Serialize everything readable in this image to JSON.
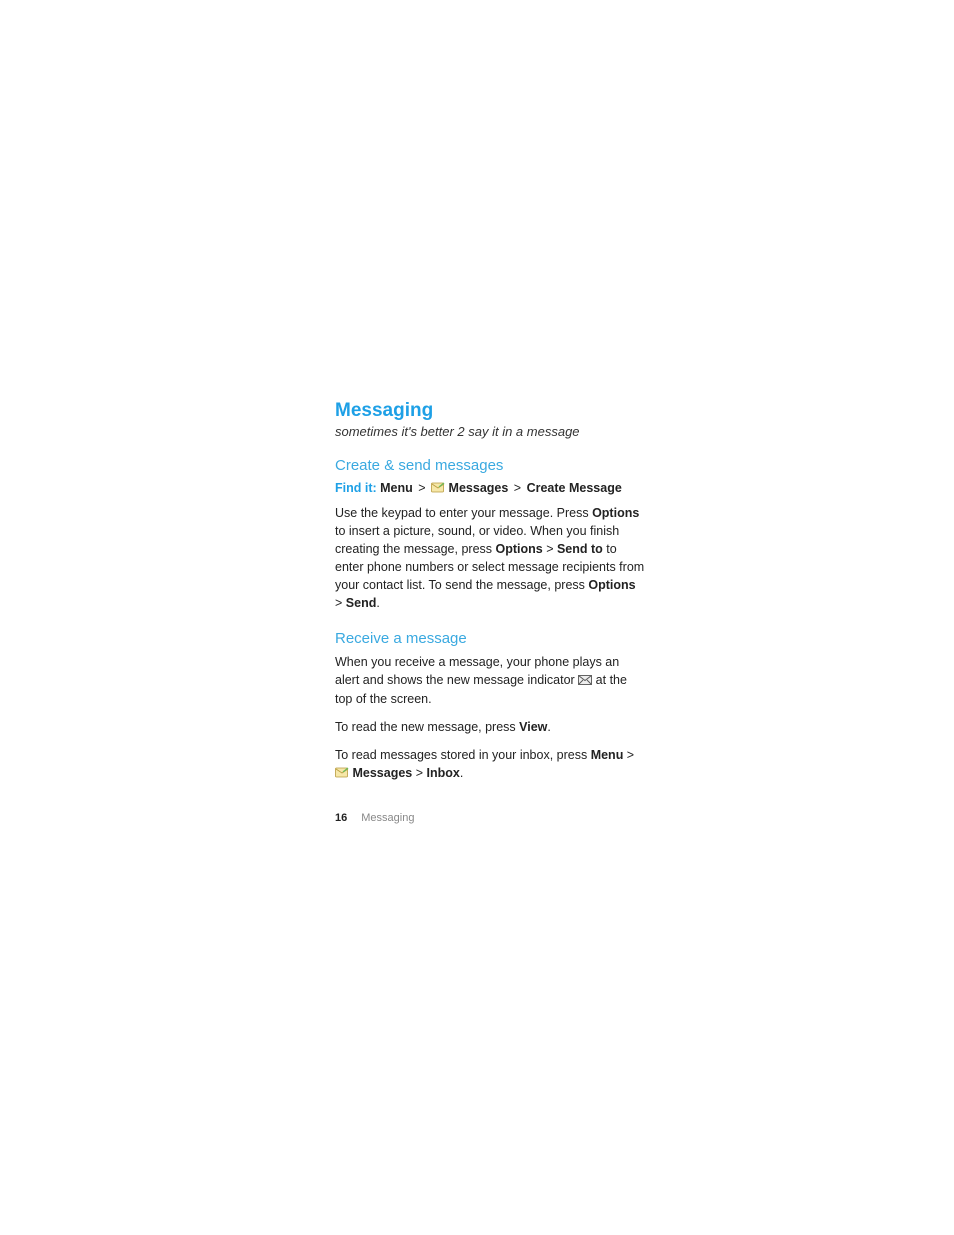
{
  "title": "Messaging",
  "subtitle": "sometimes it's better 2 say it in a message",
  "section1": {
    "heading": "Create & send messages",
    "findit_label": "Find it:",
    "path_menu": "Menu",
    "path_messages": "Messages",
    "path_create": "Create Message",
    "sep": ">",
    "p1_a": "Use the keypad to enter your message. Press ",
    "p1_options1": "Options",
    "p1_b": " to insert a picture, sound, or video. When you finish creating the message, press ",
    "p1_options2": "Options",
    "p1_c": " > ",
    "p1_sendto": "Send to",
    "p1_d": " to enter phone numbers or select message recipients from your contact list. To send the message, press ",
    "p1_options3": "Options",
    "p1_e": " > ",
    "p1_send": "Send",
    "p1_f": "."
  },
  "section2": {
    "heading": "Receive a message",
    "p1_a": "When you receive a message, your phone plays an alert and shows the new message indicator ",
    "p1_b": " at the top of the screen.",
    "p2_a": "To read the new message, press ",
    "p2_view": "View",
    "p2_b": ".",
    "p3_a": "To read messages stored in your inbox, press ",
    "p3_menu": "Menu",
    "p3_b": " > ",
    "p3_messages": "Messages",
    "p3_c": " > ",
    "p3_inbox": "Inbox",
    "p3_d": "."
  },
  "footer": {
    "pagenum": "16",
    "section": "Messaging"
  }
}
